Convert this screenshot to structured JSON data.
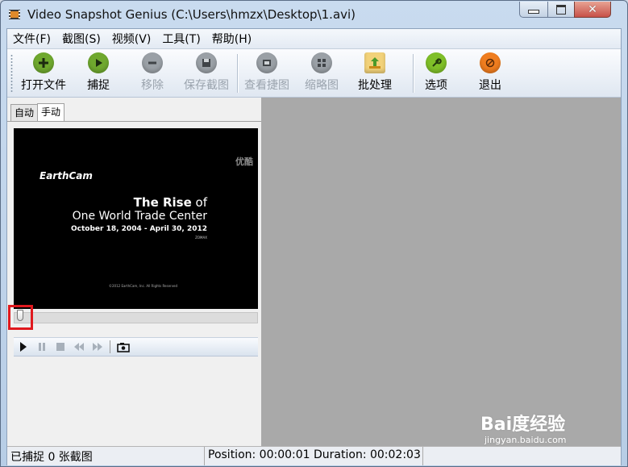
{
  "window": {
    "title": "Video Snapshot Genius (C:\\Users\\hmzx\\Desktop\\1.avi)",
    "minimize_symbol": "–",
    "maximize_symbol": "□",
    "close_symbol": "✕"
  },
  "menu": [
    "文件(F)",
    "截图(S)",
    "视频(V)",
    "工具(T)",
    "帮助(H)"
  ],
  "toolbar": {
    "open": {
      "label": "打开文件",
      "icon": "plus-icon",
      "color": "#6fa82e",
      "enabled": true
    },
    "capture": {
      "label": "捕捉",
      "icon": "play-icon",
      "color": "#6fa82e",
      "enabled": true
    },
    "remove": {
      "label": "移除",
      "icon": "minus-icon",
      "color": "#9aa0a6",
      "enabled": false
    },
    "save": {
      "label": "保存截图",
      "icon": "disk-icon",
      "color": "#9aa0a6",
      "enabled": false
    },
    "view": {
      "label": "查看捷图",
      "icon": "view-icon",
      "color": "#9aa0a6",
      "enabled": false
    },
    "thumbnail": {
      "label": "缩略图",
      "icon": "grid-icon",
      "color": "#9aa0a6",
      "enabled": false
    },
    "batch": {
      "label": "批处理",
      "icon": "folder-arrow-icon",
      "color": "#e0a526",
      "enabled": true
    },
    "options": {
      "label": "选项",
      "icon": "wrench-icon",
      "color": "#7fbf28",
      "enabled": true
    },
    "exit": {
      "label": "退出",
      "icon": "stop-icon",
      "color": "#ef7d1f",
      "enabled": true
    }
  },
  "tabs": {
    "auto": "自动",
    "manual": "手动",
    "active": "手动"
  },
  "video_frame": {
    "watermark": "优酷",
    "brand": "EarthCam",
    "title_line1_bold": "The Rise",
    "title_line1_rest": " of",
    "title_line2": "One World Trade Center",
    "dates": "October 18, 2004 - April 30, 2012",
    "small_tag": "ZOMAX",
    "copyright": "©2012 EarthCam, Inc. All Rights Reserved"
  },
  "seek_position": 0.008,
  "status": {
    "captured": "已捕捉 0 张截图",
    "position_label": "Position: 00:00:01",
    "duration_label": "Duration: 00:02:03"
  },
  "overlay": {
    "watermark": "Bai度经验",
    "url": "jingyan.baidu.com"
  }
}
